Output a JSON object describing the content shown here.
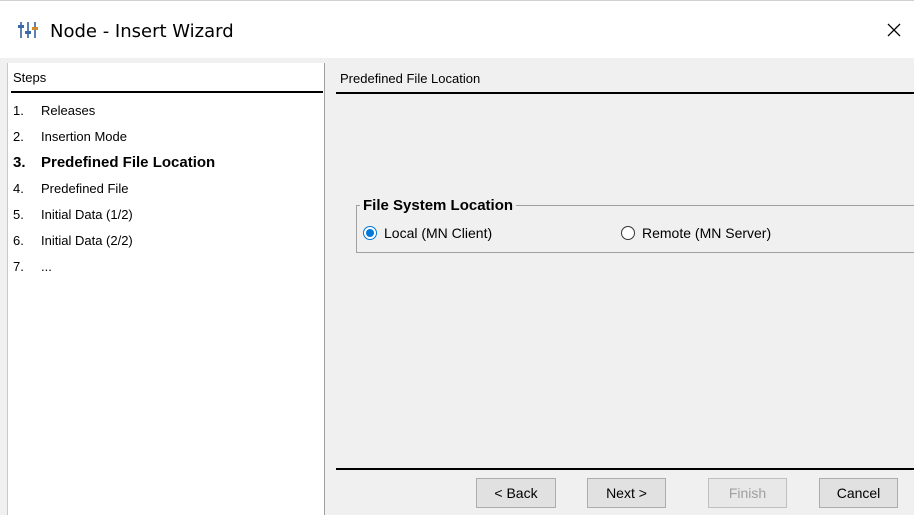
{
  "window": {
    "title": "Node - Insert Wizard",
    "app_icon": "sliders-icon",
    "close_icon": "close-icon"
  },
  "steps": {
    "header": "Steps",
    "items": [
      {
        "num": "1.",
        "label": "Releases",
        "current": false
      },
      {
        "num": "2.",
        "label": "Insertion Mode",
        "current": false
      },
      {
        "num": "3.",
        "label": "Predefined File Location",
        "current": true
      },
      {
        "num": "4.",
        "label": "Predefined File",
        "current": false
      },
      {
        "num": "5.",
        "label": "Initial Data (1/2)",
        "current": false
      },
      {
        "num": "6.",
        "label": "Initial Data (2/2)",
        "current": false
      },
      {
        "num": "7.",
        "label": "...",
        "current": false
      }
    ]
  },
  "content": {
    "header": "Predefined File Location",
    "group": {
      "legend": "File System Location",
      "options": [
        {
          "label": "Local (MN Client)",
          "selected": true
        },
        {
          "label": "Remote (MN Server)",
          "selected": false
        }
      ]
    }
  },
  "buttons": {
    "back": "< Back",
    "next": "Next >",
    "finish": "Finish",
    "cancel": "Cancel"
  },
  "colors": {
    "accent": "#0078d7",
    "panel": "#f0f0f0"
  }
}
